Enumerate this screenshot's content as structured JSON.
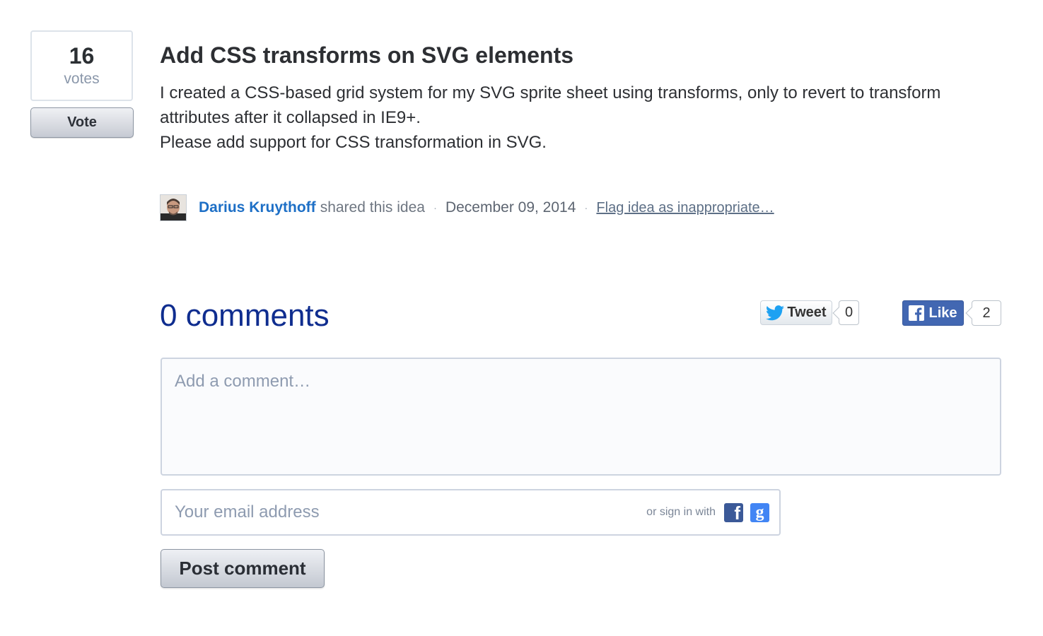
{
  "vote": {
    "count": "16",
    "label": "votes",
    "button_label": "Vote"
  },
  "idea": {
    "title": "Add CSS transforms on SVG elements",
    "description_lines": [
      "I created a CSS-based grid system for my SVG sprite sheet using transforms, only to revert to transform attributes after it collapsed in IE9+.",
      "Please add support for CSS transformation in SVG."
    ]
  },
  "meta": {
    "author": "Darius Kruythoff",
    "action": "shared this idea",
    "separator": "·",
    "date": "December 09, 2014",
    "flag_label": "Flag idea as inappropriate…"
  },
  "comments": {
    "title": "0 comments"
  },
  "social": {
    "tweet_label": "Tweet",
    "tweet_count": "0",
    "like_label": "Like",
    "like_count": "2"
  },
  "form": {
    "comment_placeholder": "Add a comment…",
    "email_placeholder": "Your email address",
    "signin_label": "or sign in with",
    "facebook_glyph": "f",
    "google_glyph": "g",
    "post_label": "Post comment"
  },
  "colors": {
    "link_blue": "#1d6fc6",
    "comments_title": "#0f2d8f",
    "facebook": "#3b5998",
    "google": "#4285f4",
    "twitter": "#1da1f2"
  },
  "icons": [
    "twitter-bird-icon",
    "facebook-f-icon",
    "facebook-icon",
    "google-icon",
    "avatar"
  ]
}
